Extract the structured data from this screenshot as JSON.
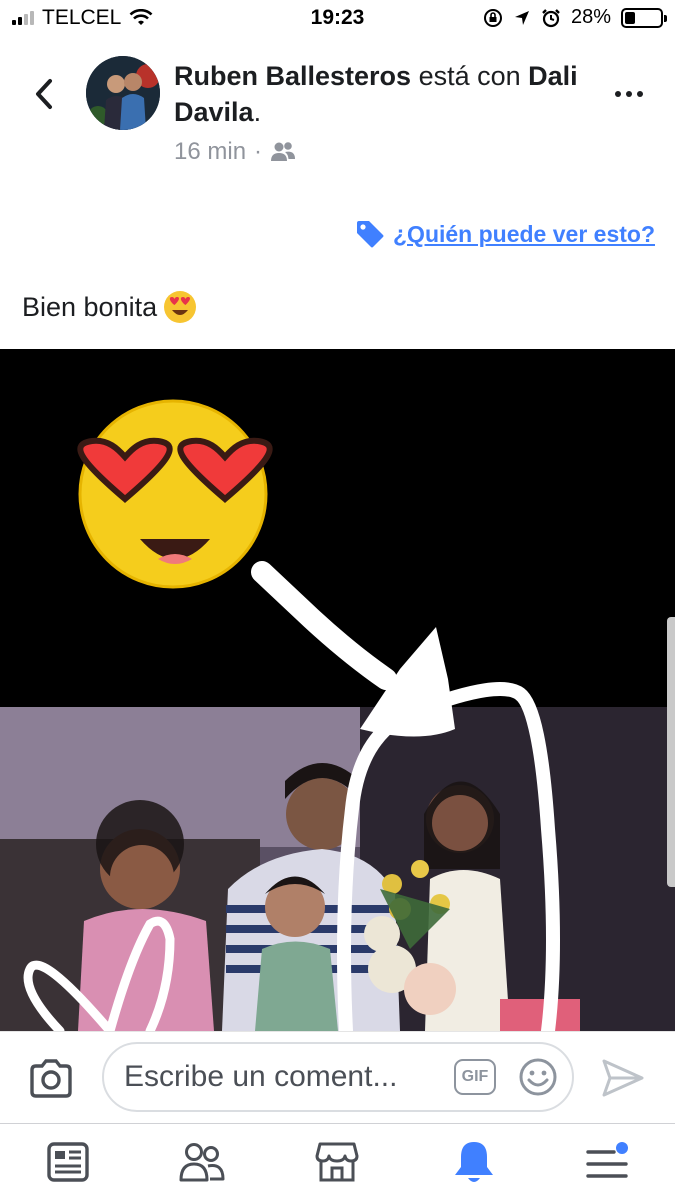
{
  "status_bar": {
    "carrier": "TELCEL",
    "time": "19:23",
    "battery_percent": "28%",
    "battery_level": 0.28
  },
  "post": {
    "author": "Ruben Ballesteros",
    "connector": " está con ",
    "tagged": "Dali Davila",
    "tail": ".",
    "time_ago": "16 min",
    "separator": "·",
    "privacy_link": "¿Quién puede ver esto?",
    "text": "Bien bonita"
  },
  "comment_bar": {
    "placeholder": "Escribe un coment...",
    "gif_label": "GIF"
  },
  "tab_bar": {
    "items": [
      "news-feed",
      "friends",
      "marketplace",
      "notifications",
      "menu"
    ],
    "active": "notifications"
  },
  "colors": {
    "accent": "#4080ff",
    "text": "#1c1e21",
    "muted": "#90949c",
    "icon": "#4b4f56"
  }
}
